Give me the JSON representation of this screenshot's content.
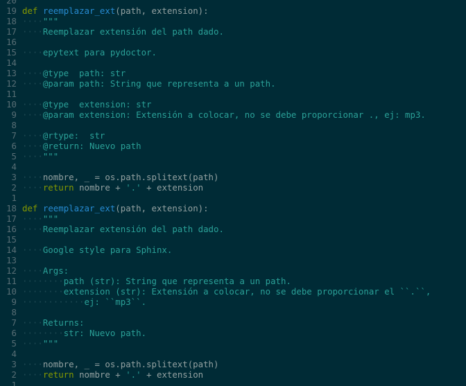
{
  "colors": {
    "background": "#002b36",
    "line_number": "#586e75",
    "keyword": "#859900",
    "function": "#268bd2",
    "string": "#2aa198",
    "whitespace_marker": "#1f4a54",
    "plain": "#93a1a1"
  },
  "lines": [
    {
      "num": "20",
      "tokens": []
    },
    {
      "num": "19",
      "tokens": [
        {
          "t": "def",
          "c": "kw"
        },
        {
          "t": " ",
          "c": "plain"
        },
        {
          "t": "reemplazar_ext",
          "c": "fn"
        },
        {
          "t": "(path, extension):",
          "c": "plain"
        }
      ]
    },
    {
      "num": "18",
      "tokens": [
        {
          "t": "····",
          "c": "ws"
        },
        {
          "t": "\"\"\"",
          "c": "str"
        }
      ]
    },
    {
      "num": "17",
      "tokens": [
        {
          "t": "····",
          "c": "ws"
        },
        {
          "t": "Reemplazar extensión del path dado.",
          "c": "str"
        }
      ]
    },
    {
      "num": "16",
      "tokens": []
    },
    {
      "num": "15",
      "tokens": [
        {
          "t": "····",
          "c": "ws"
        },
        {
          "t": "epytext para pydoctor.",
          "c": "str"
        }
      ]
    },
    {
      "num": "14",
      "tokens": []
    },
    {
      "num": "13",
      "tokens": [
        {
          "t": "····",
          "c": "ws"
        },
        {
          "t": "@type  path: str",
          "c": "str"
        }
      ]
    },
    {
      "num": "12",
      "tokens": [
        {
          "t": "····",
          "c": "ws"
        },
        {
          "t": "@param path: String que representa a un path.",
          "c": "str"
        }
      ]
    },
    {
      "num": "11",
      "tokens": []
    },
    {
      "num": "10",
      "tokens": [
        {
          "t": "····",
          "c": "ws"
        },
        {
          "t": "@type  extension: str",
          "c": "str"
        }
      ]
    },
    {
      "num": "9",
      "tokens": [
        {
          "t": "····",
          "c": "ws"
        },
        {
          "t": "@param extension: Extensión a colocar, no se debe proporcionar ., ej: mp3.",
          "c": "str"
        }
      ]
    },
    {
      "num": "8",
      "tokens": []
    },
    {
      "num": "7",
      "tokens": [
        {
          "t": "····",
          "c": "ws"
        },
        {
          "t": "@rtype:  str",
          "c": "str"
        }
      ]
    },
    {
      "num": "6",
      "tokens": [
        {
          "t": "····",
          "c": "ws"
        },
        {
          "t": "@return: Nuevo path",
          "c": "str"
        }
      ]
    },
    {
      "num": "5",
      "tokens": [
        {
          "t": "····",
          "c": "ws"
        },
        {
          "t": "\"\"\"",
          "c": "str"
        }
      ]
    },
    {
      "num": "4",
      "tokens": []
    },
    {
      "num": "3",
      "tokens": [
        {
          "t": "····",
          "c": "ws"
        },
        {
          "t": "nombre, _ = os.path.splitext(path)",
          "c": "plain"
        }
      ]
    },
    {
      "num": "2",
      "tokens": [
        {
          "t": "····",
          "c": "ws"
        },
        {
          "t": "return",
          "c": "kw"
        },
        {
          "t": " nombre + ",
          "c": "plain"
        },
        {
          "t": "'.'",
          "c": "str"
        },
        {
          "t": " + extension",
          "c": "plain"
        }
      ]
    },
    {
      "num": "1",
      "tokens": []
    },
    {
      "num": "18",
      "tokens": [
        {
          "t": "def",
          "c": "kw"
        },
        {
          "t": " ",
          "c": "plain"
        },
        {
          "t": "reemplazar_ext",
          "c": "fn"
        },
        {
          "t": "(path, extension):",
          "c": "plain"
        }
      ]
    },
    {
      "num": "17",
      "tokens": [
        {
          "t": "····",
          "c": "ws"
        },
        {
          "t": "\"\"\"",
          "c": "str"
        }
      ]
    },
    {
      "num": "16",
      "tokens": [
        {
          "t": "····",
          "c": "ws"
        },
        {
          "t": "Reemplazar extensión del path dado.",
          "c": "str"
        }
      ]
    },
    {
      "num": "15",
      "tokens": []
    },
    {
      "num": "14",
      "tokens": [
        {
          "t": "····",
          "c": "ws"
        },
        {
          "t": "Google style para Sphinx.",
          "c": "str"
        }
      ]
    },
    {
      "num": "13",
      "tokens": []
    },
    {
      "num": "12",
      "tokens": [
        {
          "t": "····",
          "c": "ws"
        },
        {
          "t": "Args:",
          "c": "str"
        }
      ]
    },
    {
      "num": "11",
      "tokens": [
        {
          "t": "········",
          "c": "ws"
        },
        {
          "t": "path (str): String que representa a un path.",
          "c": "str"
        }
      ]
    },
    {
      "num": "10",
      "tokens": [
        {
          "t": "········",
          "c": "ws"
        },
        {
          "t": "extension (str): Extensión a colocar, no se debe proporcionar el ``.``,",
          "c": "str"
        }
      ]
    },
    {
      "num": "9",
      "tokens": [
        {
          "t": "············",
          "c": "ws"
        },
        {
          "t": "ej: ``mp3``.",
          "c": "str"
        }
      ]
    },
    {
      "num": "8",
      "tokens": []
    },
    {
      "num": "7",
      "tokens": [
        {
          "t": "····",
          "c": "ws"
        },
        {
          "t": "Returns:",
          "c": "str"
        }
      ]
    },
    {
      "num": "6",
      "tokens": [
        {
          "t": "········",
          "c": "ws"
        },
        {
          "t": "str: Nuevo path.",
          "c": "str"
        }
      ]
    },
    {
      "num": "5",
      "tokens": [
        {
          "t": "····",
          "c": "ws"
        },
        {
          "t": "\"\"\"",
          "c": "str"
        }
      ]
    },
    {
      "num": "4",
      "tokens": []
    },
    {
      "num": "3",
      "tokens": [
        {
          "t": "····",
          "c": "ws"
        },
        {
          "t": "nombre, _ = os.path.splitext(path)",
          "c": "plain"
        }
      ]
    },
    {
      "num": "2",
      "tokens": [
        {
          "t": "····",
          "c": "ws"
        },
        {
          "t": "return",
          "c": "kw"
        },
        {
          "t": " nombre + ",
          "c": "plain"
        },
        {
          "t": "'.'",
          "c": "str"
        },
        {
          "t": " + extension",
          "c": "plain"
        }
      ]
    },
    {
      "num": "1",
      "tokens": []
    }
  ]
}
